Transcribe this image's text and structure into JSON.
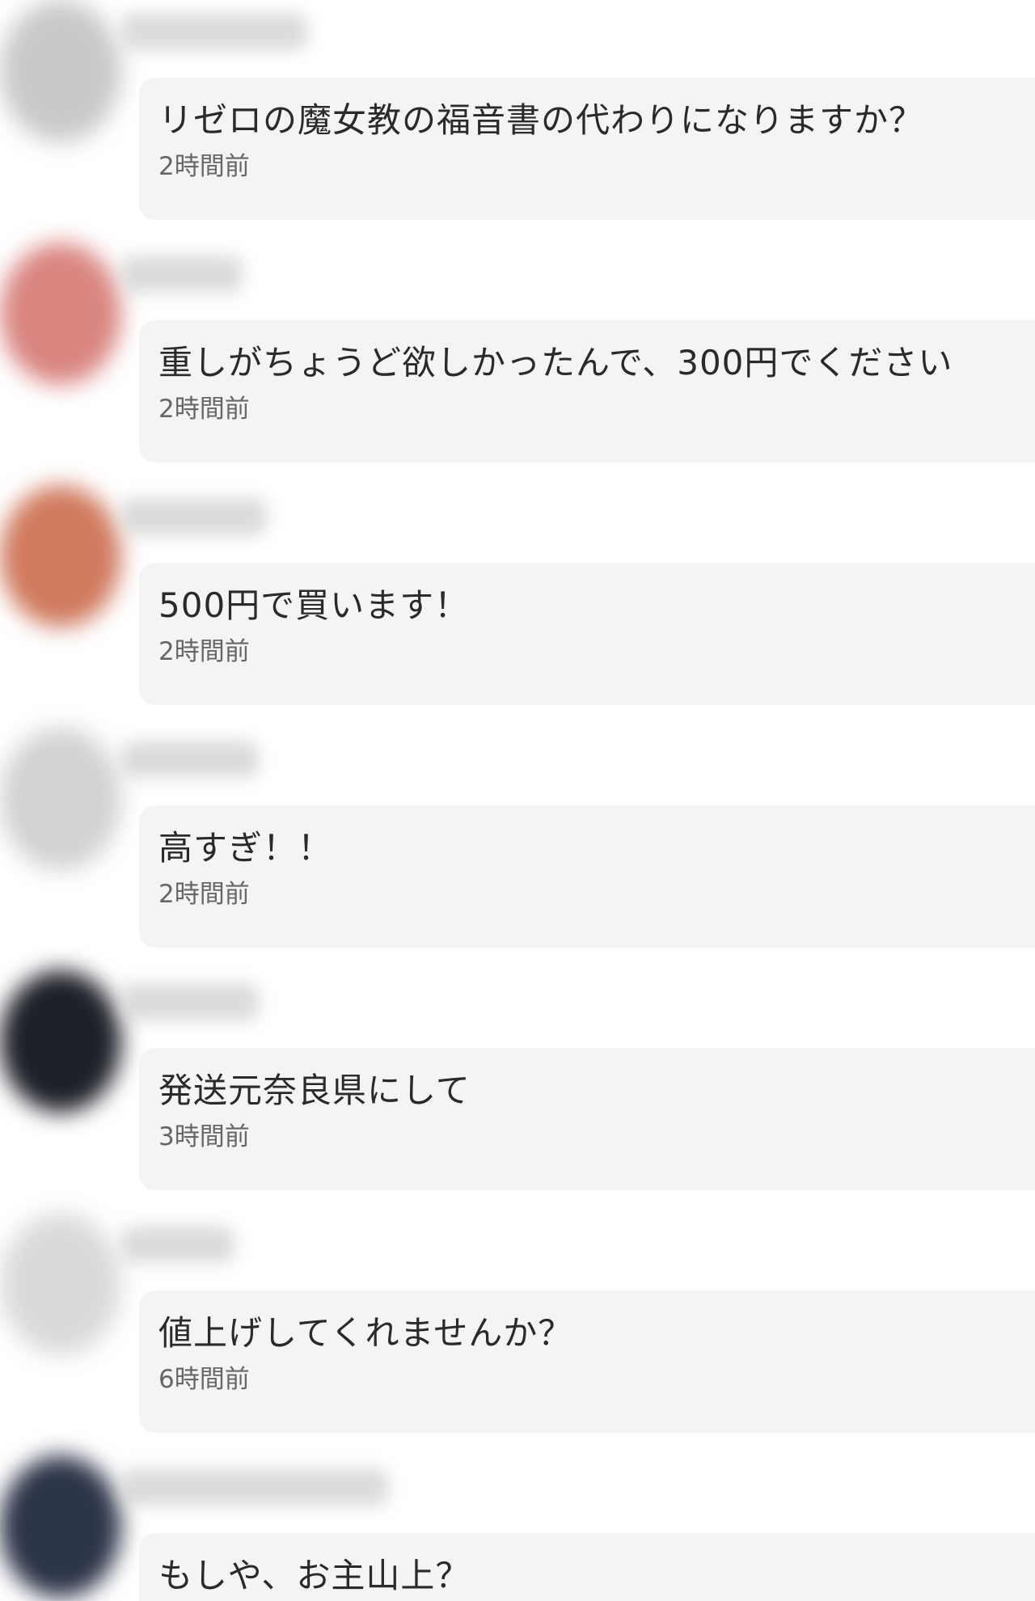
{
  "comments": [
    {
      "text": "リゼロの魔女教の福音書の代わりになりますか？",
      "time": "2時間前",
      "avatar_color": "#c9c9c9"
    },
    {
      "text": "重しがちょうど欲しかったんで、300円でください",
      "time": "2時間前",
      "avatar_color": "#d98580"
    },
    {
      "text": "500円で買います！",
      "time": "2時間前",
      "avatar_color": "#d07a5e"
    },
    {
      "text": "高すぎ！！",
      "time": "2時間前",
      "avatar_color": "#d2d2d2"
    },
    {
      "text": "発送元奈良県にして",
      "time": "3時間前",
      "avatar_color": "#1e2028"
    },
    {
      "text": "値上げしてくれませんか？",
      "time": "6時間前",
      "avatar_color": "#dadada"
    },
    {
      "text": "もしや、お主山上？",
      "time": "",
      "avatar_color": "#2c3448"
    }
  ]
}
